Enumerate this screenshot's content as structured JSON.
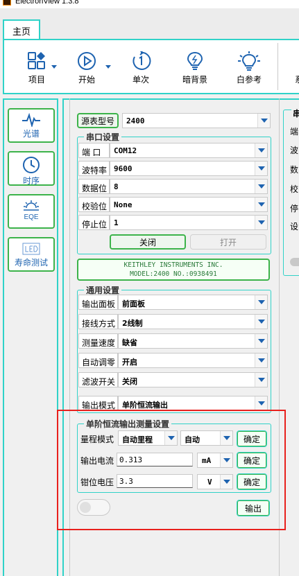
{
  "app": {
    "title": "ElectronView 1.3.8"
  },
  "tabs": {
    "home": "主页"
  },
  "ribbon": {
    "items": [
      {
        "label": "项目",
        "icon": "project-icon"
      },
      {
        "label": "开始",
        "icon": "play-icon"
      },
      {
        "label": "单次",
        "icon": "single-icon"
      },
      {
        "label": "暗背景",
        "icon": "dark-bulb-icon"
      },
      {
        "label": "白参考",
        "icon": "light-bulb-icon"
      },
      {
        "label": "系"
      }
    ]
  },
  "leftnav": {
    "items": [
      {
        "label": "光谱",
        "icon": "spectrum-icon"
      },
      {
        "label": "时序",
        "icon": "clock-icon"
      },
      {
        "label": "EQE",
        "icon": "eqe-icon"
      },
      {
        "label": "寿命测试",
        "icon": "led-icon"
      }
    ]
  },
  "source": {
    "label": "源表型号",
    "value": "2400"
  },
  "serial": {
    "title": "串口设置",
    "rows": [
      {
        "label": "端 口",
        "value": "COM12"
      },
      {
        "label": "波特率",
        "value": "9600"
      },
      {
        "label": "数据位",
        "value": "8"
      },
      {
        "label": "校验位",
        "value": "None"
      },
      {
        "label": "停止位",
        "value": "1"
      }
    ],
    "close_label": "关闭",
    "open_label": "打开"
  },
  "info": {
    "line1": "KEITHLEY INSTRUMENTS INC.",
    "line2": "MODEL:2400 NO.:0938491"
  },
  "general": {
    "title": "通用设置",
    "rows": [
      {
        "label": "输出面板",
        "value": "前面板"
      },
      {
        "label": "接线方式",
        "value": "2线制"
      },
      {
        "label": "测量速度",
        "value": "缺省"
      },
      {
        "label": "自动调零",
        "value": "开启"
      },
      {
        "label": "滤波开关",
        "value": "关闭"
      },
      {
        "label": "输出模式",
        "value": "单阶恒流输出"
      }
    ]
  },
  "step": {
    "title": "单阶恒流输出测量设置",
    "range_label": "量程模式",
    "range_value": "自动里程",
    "range_sub": "自动",
    "current_label": "输出电流",
    "current_value": "0.313",
    "current_unit": "mA",
    "voltage_label": "钳位电压",
    "voltage_value": "3.3",
    "voltage_unit": "V",
    "confirm": "确定"
  },
  "output_label": "输出",
  "right_panel": {
    "title": "串",
    "labels": [
      "端",
      "波",
      "数",
      "校",
      "停",
      "设"
    ]
  },
  "colors": {
    "accent": "#2fd2c8",
    "green": "#3cb34a",
    "highlight": "#e8201c",
    "icon_blue": "#1e63b0"
  }
}
